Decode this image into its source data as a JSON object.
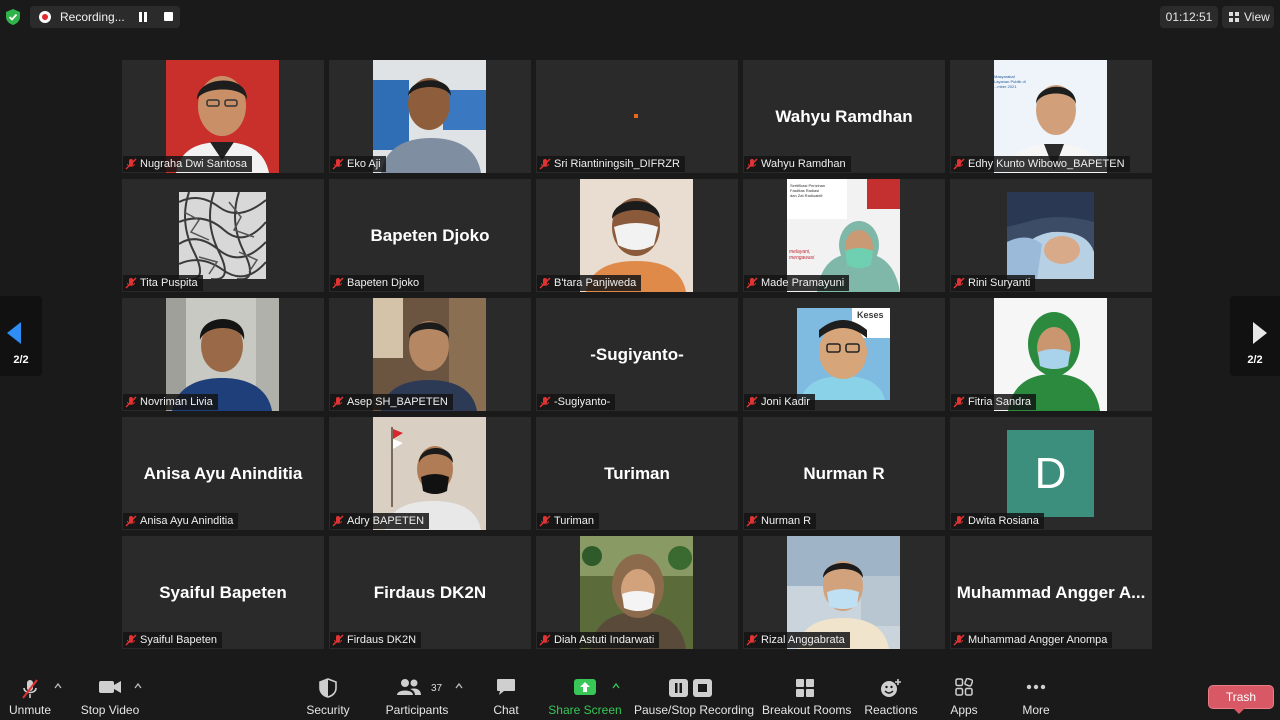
{
  "topbar": {
    "recording_label": "Recording...",
    "timer": "01:12:51",
    "view_label": "View"
  },
  "pager": {
    "left": "2/2",
    "right": "2/2"
  },
  "participants": [
    {
      "label": "Nugraha Dwi Santosa",
      "display": ""
    },
    {
      "label": "Eko Aji",
      "display": ""
    },
    {
      "label": "Sri Riantiningsih_DIFRZR",
      "display": ""
    },
    {
      "label": "Wahyu Ramdhan",
      "display": "Wahyu Ramdhan"
    },
    {
      "label": "Edhy Kunto Wibowo_BAPETEN",
      "display": ""
    },
    {
      "label": "Tita Puspita",
      "display": ""
    },
    {
      "label": "Bapeten Djoko",
      "display": "Bapeten Djoko"
    },
    {
      "label": "B'tara Panjiweda",
      "display": ""
    },
    {
      "label": "Made Pramayuni",
      "display": ""
    },
    {
      "label": "Rini Suryanti",
      "display": ""
    },
    {
      "label": "Novriman Livia",
      "display": ""
    },
    {
      "label": "Asep SH_BAPETEN",
      "display": ""
    },
    {
      "label": "-Sugiyanto-",
      "display": "-Sugiyanto-"
    },
    {
      "label": "Joni Kadir",
      "display": ""
    },
    {
      "label": "Fitria Sandra",
      "display": ""
    },
    {
      "label": "Anisa Ayu Aninditia",
      "display": "Anisa Ayu Aninditia"
    },
    {
      "label": "Adry BAPETEN",
      "display": ""
    },
    {
      "label": "Turiman",
      "display": "Turiman"
    },
    {
      "label": "Nurman R",
      "display": "Nurman R"
    },
    {
      "label": "Dwita Rosiana",
      "display": ""
    },
    {
      "label": "Syaiful Bapeten",
      "display": "Syaiful Bapeten"
    },
    {
      "label": "Firdaus DK2N",
      "display": "Firdaus DK2N"
    },
    {
      "label": "Diah Astuti Indarwati",
      "display": ""
    },
    {
      "label": "Rizal Anggabrata",
      "display": ""
    },
    {
      "label": "Muhammad Angger Anompa",
      "display": "Muhammad Angger A..."
    }
  ],
  "tile_texts": {
    "dwita_initial": "D",
    "edhy_slide": [
      "Masyarakat",
      "Layanan Publik di",
      "...mber 2021"
    ],
    "made_slide": [
      "Sertifikasi Perizinan",
      "Fasilitas Radiasi",
      "dan Zat Radioaktif",
      "melayani,",
      "mengawasi"
    ],
    "joni_bg": "Keses"
  },
  "toolbar": {
    "unmute": "Unmute",
    "stop_video": "Stop Video",
    "security": "Security",
    "participants": "Participants",
    "participants_count": "37",
    "chat": "Chat",
    "share_screen": "Share Screen",
    "pause_stop_recording": "Pause/Stop Recording",
    "breakout_rooms": "Breakout Rooms",
    "reactions": "Reactions",
    "apps": "Apps",
    "more": "More",
    "trash": "Trash"
  },
  "colors": {
    "background": "#1a1a1a",
    "tile": "#2a2a2a",
    "share_green": "#38c757",
    "mute_red": "#e03333",
    "avatar_teal": "#3c8f7c",
    "recording_red": "#e02828"
  }
}
